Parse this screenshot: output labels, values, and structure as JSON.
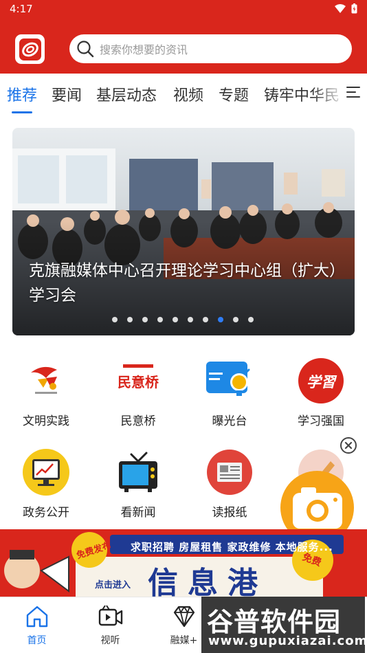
{
  "status_bar": {
    "time": "4:17"
  },
  "search": {
    "placeholder": "搜索你想要的资讯"
  },
  "tabs": [
    {
      "label": "推荐",
      "active": true
    },
    {
      "label": "要闻",
      "active": false
    },
    {
      "label": "基层动态",
      "active": false
    },
    {
      "label": "视频",
      "active": false
    },
    {
      "label": "专题",
      "active": false
    },
    {
      "label": "铸牢中华民",
      "active": false
    }
  ],
  "banner": {
    "caption": "克旗融媒体中心召开理论学习中心组（扩大）学习会",
    "slide_count": 10,
    "active_slide": 8
  },
  "quick_links": [
    {
      "label": "文明实践",
      "icon": "civilization-practice-icon"
    },
    {
      "label": "民意桥",
      "icon": "public-opinion-bridge-icon",
      "icon_text": "民意桥"
    },
    {
      "label": "曝光台",
      "icon": "exposure-platform-icon"
    },
    {
      "label": "学习强国",
      "icon": "study-strong-nation-icon",
      "icon_text": "学習"
    },
    {
      "label": "政务公开",
      "icon": "government-affairs-icon"
    },
    {
      "label": "看新闻",
      "icon": "tv-news-icon"
    },
    {
      "label": "读报纸",
      "icon": "newspaper-icon"
    }
  ],
  "ad_banner": {
    "services": "求职招聘  房屋租售  家政维修  本地服务...",
    "badge": "免费发布",
    "title": "信息港",
    "cta": "点击进入",
    "badge_right": "免费"
  },
  "bottom_nav": [
    {
      "label": "首页",
      "icon": "home-icon",
      "active": true
    },
    {
      "label": "视听",
      "icon": "video-icon",
      "active": false
    },
    {
      "label": "融媒+",
      "icon": "diamond-icon",
      "active": false
    }
  ],
  "watermark": {
    "title": "谷普软件园",
    "url": "www.gupuxiazai.com"
  },
  "colors": {
    "brand_red": "#d9261c",
    "accent_blue": "#1a73e8",
    "camera_orange": "#f7a417"
  }
}
